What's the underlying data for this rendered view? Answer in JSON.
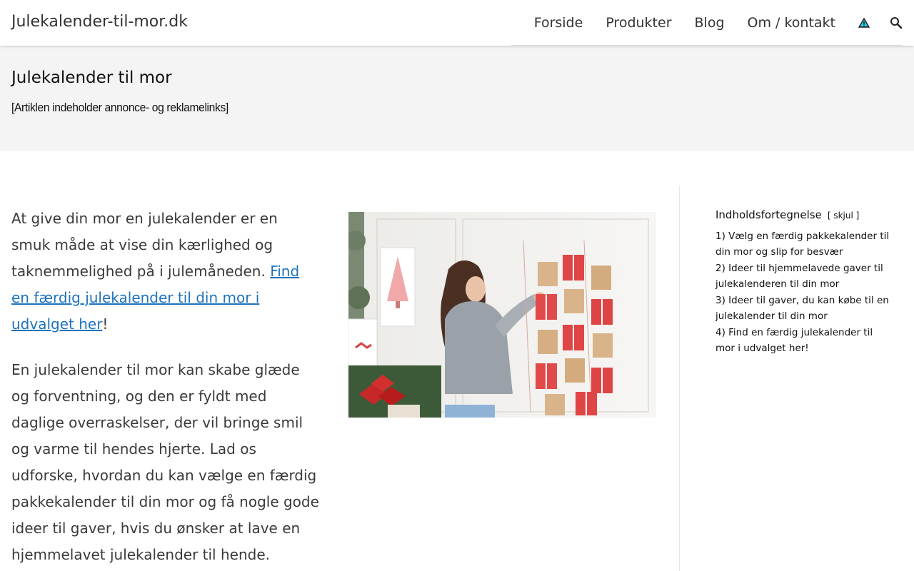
{
  "header": {
    "site_title": "Julekalender-til-mor.dk",
    "nav": [
      {
        "label": "Forside"
      },
      {
        "label": "Produkter"
      },
      {
        "label": "Blog"
      },
      {
        "label": "Om / kontakt"
      }
    ],
    "icons": {
      "alert": "warning-triangle-icon",
      "search": "search-icon"
    }
  },
  "hero": {
    "title": "Julekalender til mor",
    "disclaimer": "[Artiklen indeholder annonce- og reklamelinks]"
  },
  "content": {
    "p1_text": "At give din mor en julekalender er en smuk måde at vise din kærlighed og taknemmelighed på i julemåneden. ",
    "p1_link": "Find en færdig julekalender til din mor i udvalget her",
    "p1_end": "!",
    "p2": "En julekalender til mor kan skabe glæde og forventning, og den er fyldt med daglige overraskelser, der vil bringe smil og varme til hendes hjerte. Lad os udforske, hvordan du kan vælge en færdig pakkekalender til din mor og få nogle gode ideer til gaver, hvis du ønsker at lave en hjemmelavet julekalender til hende."
  },
  "toc": {
    "title": "Indholdsfortegnelse",
    "toggle": "[ skjul ]",
    "items": [
      {
        "label": "1) Vælg en færdig pakkekalender til din mor og slip for besvær"
      },
      {
        "label": "2) Ideer til hjemmelavede gaver til julekalenderen til din mor"
      },
      {
        "label": "3) Ideer til gaver, du kan købe til en julekalender til din mor"
      },
      {
        "label": "4) Find en færdig julekalender til mor i udvalget her!"
      }
    ]
  },
  "colors": {
    "link": "#1e73be",
    "hero_bg": "#f4f4f4"
  }
}
